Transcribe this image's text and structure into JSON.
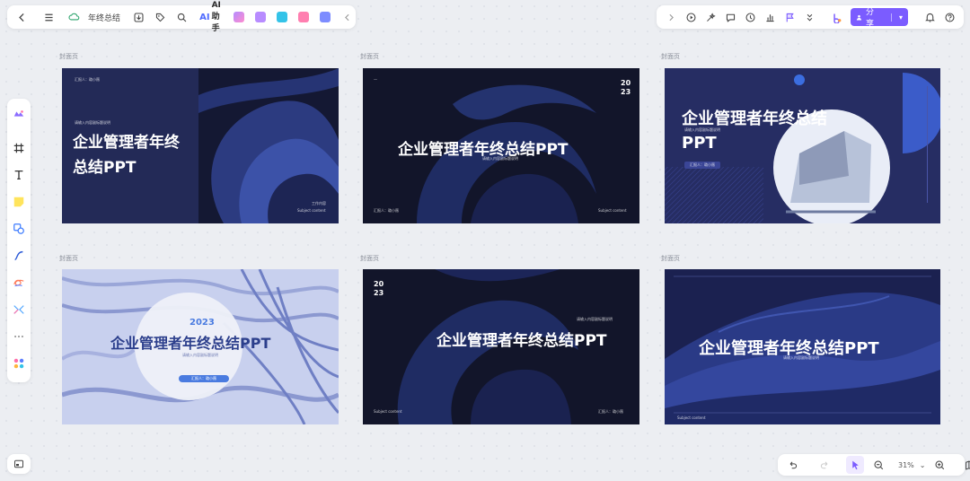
{
  "toolbar_left": {
    "doc_title": "年终总结",
    "ai_label": "AI助手",
    "ai_mark": "AI"
  },
  "toolbar_right": {
    "share_label": "分享"
  },
  "zoom": {
    "level": "31%"
  },
  "frames": [
    {
      "label": "封面页",
      "title_line1": "企业管理者年终",
      "title_line2": "总结PPT",
      "subtitle": "请输入内容副标题说明",
      "presenter": "汇报人：璐小薇",
      "subject": "Subject content",
      "subject_top": "工作内容"
    },
    {
      "label": "封面页",
      "year_line1": "20",
      "year_line2": "23",
      "title": "企业管理者年终总结PPT",
      "subtitle": "请输入内容副标题说明",
      "presenter": "汇报人：璐小薇",
      "subject": "Subject content"
    },
    {
      "label": "封面页",
      "title_line1": "企业管理者年终总结",
      "title_line2": "PPT",
      "subtitle": "请输入内容副标题说明",
      "presenter": "汇报人：璐小薇"
    },
    {
      "label": "封面页",
      "year": "2023",
      "title": "企业管理者年终总结PPT",
      "subtitle": "请输入内容副标题说明",
      "presenter": "汇报人：璐小薇"
    },
    {
      "label": "封面页",
      "year_line1": "20",
      "year_line2": "23",
      "title": "企业管理者年终总结PPT",
      "subtitle": "请输入内容副标题说明",
      "presenter": "汇报人：璐小薇",
      "subject": "Subject content"
    },
    {
      "label": "封面页",
      "title": "企业管理者年终总结PPT",
      "subtitle": "请输入内容副标题说明",
      "footer": "Subject content"
    }
  ],
  "colors": {
    "share": "#7b5cff",
    "slide_dark": "#1b1f3a",
    "slide_navy": "#232a57",
    "slide_light": "#c8d0ee"
  }
}
